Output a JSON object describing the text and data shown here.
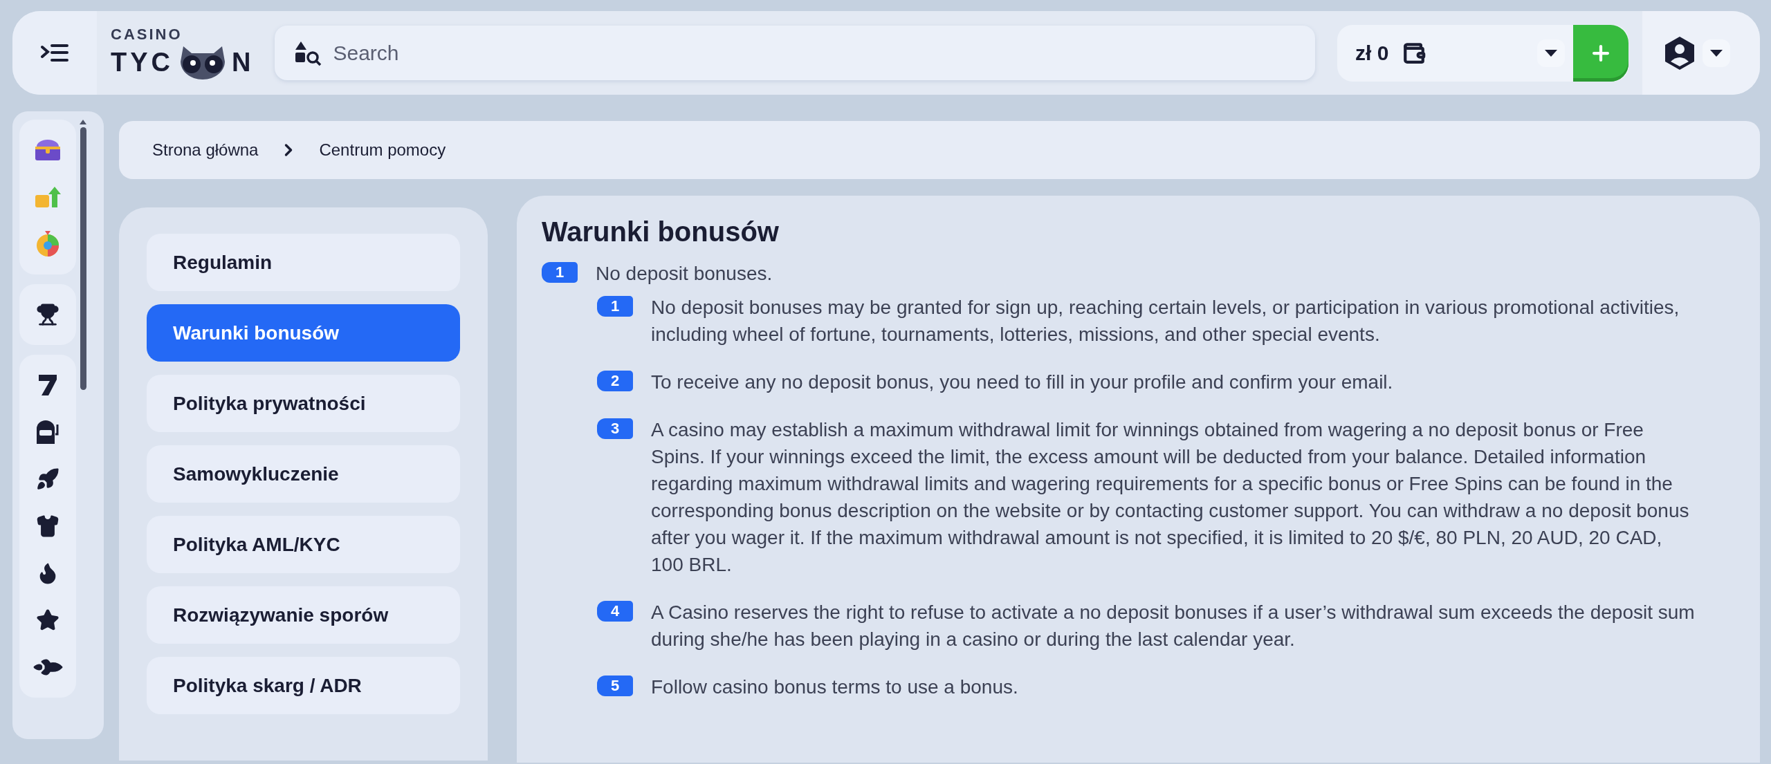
{
  "header": {
    "logo": {
      "line1": "CASINO",
      "line2_start": "TYC",
      "line2_end": "N"
    },
    "search": {
      "placeholder": "Search"
    },
    "balance": "zł 0"
  },
  "breadcrumb": [
    {
      "label": "Strona główna"
    },
    {
      "label": "Centrum pomocy"
    }
  ],
  "help_nav": [
    {
      "label": "Regulamin",
      "selected": false
    },
    {
      "label": "Warunki bonusów",
      "selected": true
    },
    {
      "label": "Polityka prywatności",
      "selected": false
    },
    {
      "label": "Samowykluczenie",
      "selected": false
    },
    {
      "label": "Polityka AML/KYC",
      "selected": false
    },
    {
      "label": "Rozwiązywanie sporów",
      "selected": false
    },
    {
      "label": "Polityka skarg / ADR",
      "selected": false
    }
  ],
  "article": {
    "title": "Warunki bonusów",
    "sections": [
      {
        "number": "1",
        "text": "No deposit bonuses.",
        "items": [
          {
            "number": "1",
            "text": "No deposit bonuses may be granted for sign up, reaching certain levels, or participation in various promotional activities, including wheel of fortune, tournaments, lotteries, missions, and other special events."
          },
          {
            "number": "2",
            "text": "To receive any no deposit bonus, you need to fill in your profile and confirm your email."
          },
          {
            "number": "3",
            "text": "A casino may establish a maximum withdrawal limit for winnings obtained from wagering a no deposit bonus or Free Spins. If your winnings exceed the limit, the excess amount will be deducted from your balance. Detailed information regarding maximum withdrawal limits and wagering requirements for a specific bonus or Free Spins can be found in the corresponding bonus description on the website or by contacting customer support. You can withdraw a no deposit bonus after you wager it. If the maximum withdrawal amount is not specified, it is limited to 20 $/€, 80 PLN, 20 AUD, 20 CAD, 100 BRL."
          },
          {
            "number": "4",
            "text": "A Casino reserves the right to refuse to activate a no deposit bonuses if a user’s withdrawal sum exceeds the deposit sum during she/he has been playing in a casino or during the last calendar year."
          },
          {
            "number": "5",
            "text": "Follow casino bonus terms to use a bonus."
          }
        ]
      }
    ]
  }
}
